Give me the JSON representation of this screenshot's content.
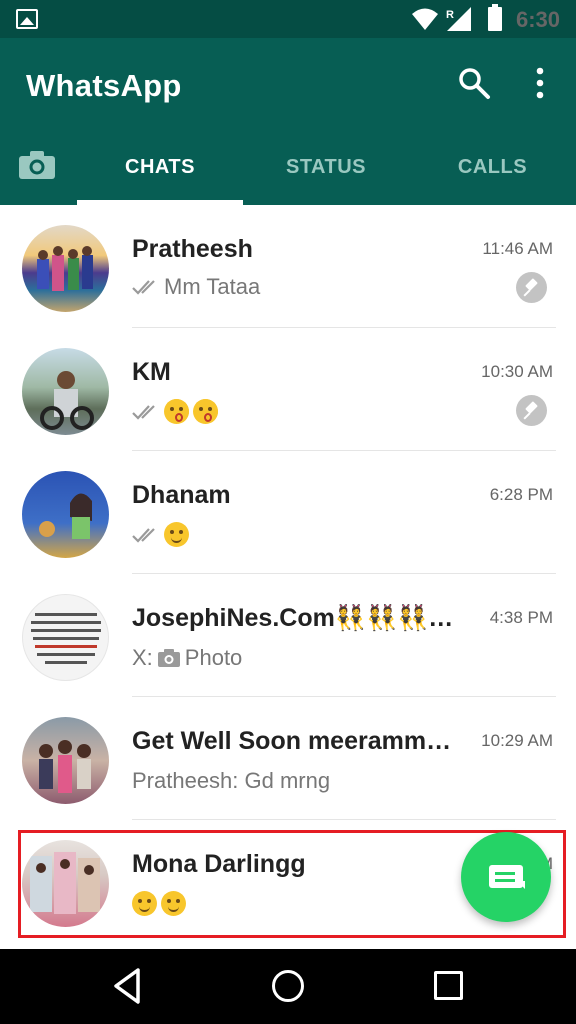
{
  "status_bar": {
    "time": "6:30",
    "network_label": "R",
    "icons": [
      "gallery-icon",
      "wifi-icon",
      "signal-icon",
      "battery-icon"
    ]
  },
  "app": {
    "title": "WhatsApp",
    "icons": [
      "search-icon",
      "more-vert-icon",
      "camera-icon"
    ]
  },
  "tabs": [
    {
      "label": "CHATS",
      "active": true
    },
    {
      "label": "STATUS",
      "active": false
    },
    {
      "label": "CALLS",
      "active": false
    }
  ],
  "chats": [
    {
      "name": "Pratheesh",
      "time": "11:46 AM",
      "preview": "Mm Tataa",
      "read_ticks": true,
      "pinned": true
    },
    {
      "name": "KM",
      "time": "10:30 AM",
      "preview": "",
      "read_ticks": true,
      "pinned": true,
      "emojis": [
        "kiss-emoji",
        "kiss-emoji"
      ]
    },
    {
      "name": "Dhanam",
      "time": "6:28 PM",
      "preview": "",
      "read_ticks": true,
      "pinned": false,
      "emojis": [
        "smile-emoji"
      ]
    },
    {
      "name": "JosephiNes.Com👯👯👯💕 …",
      "time": "4:38 PM",
      "preview_prefix": "X:",
      "preview": "Photo",
      "read_ticks": false,
      "pinned": false
    },
    {
      "name": "Get Well Soon meeramma…",
      "time": "10:29 AM",
      "preview": "Pratheesh: Gd mrng",
      "read_ticks": false,
      "pinned": false
    },
    {
      "name": "Mona Darlingg",
      "time": "M",
      "preview": "",
      "read_ticks": false,
      "pinned": false,
      "emojis": [
        "smile-emoji",
        "smile-emoji"
      ]
    }
  ],
  "colors": {
    "header": "#075e54",
    "status_bar": "#054d44",
    "fab": "#25d366",
    "highlight": "#e51d23"
  }
}
